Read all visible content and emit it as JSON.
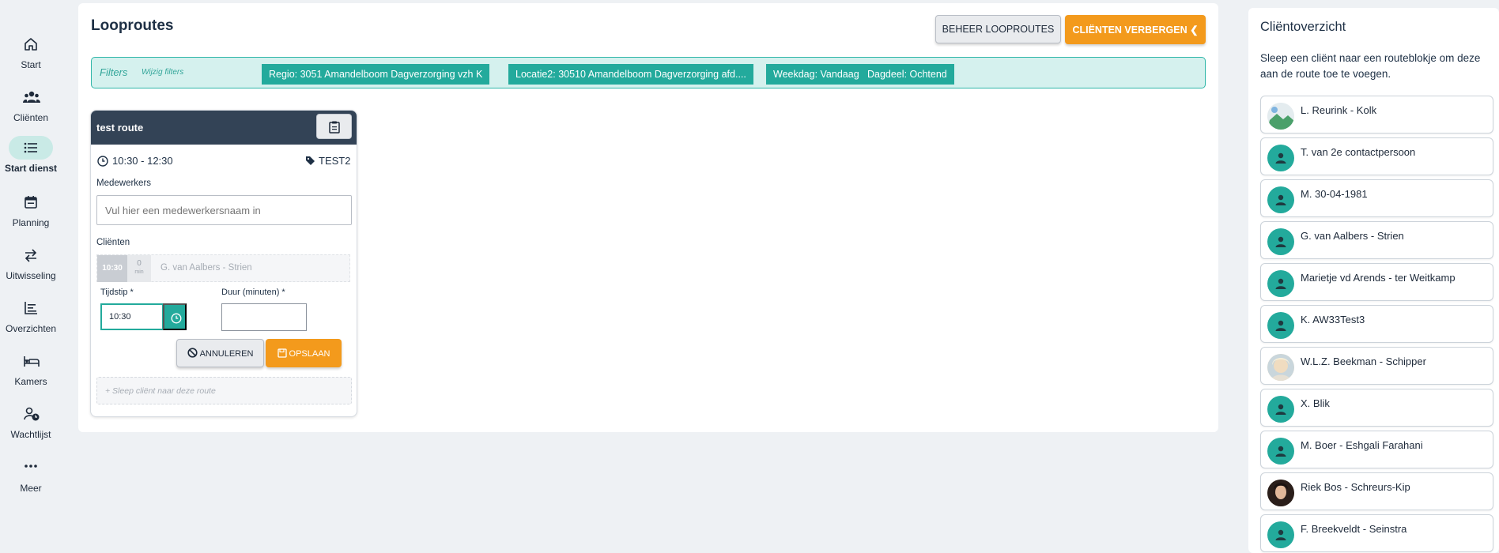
{
  "sidebar": {
    "items": [
      {
        "label": "Start",
        "icon": "home-icon"
      },
      {
        "label": "Cliënten",
        "icon": "users-icon"
      },
      {
        "label": "Start dienst",
        "icon": "list-icon",
        "active": true
      },
      {
        "label": "Planning",
        "icon": "calendar-icon"
      },
      {
        "label": "Uitwisseling",
        "icon": "exchange-icon"
      },
      {
        "label": "Overzichten",
        "icon": "chart-icon"
      },
      {
        "label": "Kamers",
        "icon": "bed-icon"
      },
      {
        "label": "Wachtlijst",
        "icon": "user-clock-icon"
      },
      {
        "label": "Meer",
        "icon": "more-icon"
      }
    ]
  },
  "header": {
    "title": "Looproutes",
    "beheer_label": "BEHEER LOOPROUTES",
    "verbergen_label": "CLIËNTEN VERBERGEN"
  },
  "filters": {
    "title": "Filters",
    "edit_label": "Wijzig filters",
    "chips": [
      "Regio: 3051 Amandelboom Dagverzorging vzh K",
      "Locatie2: 30510 Amandelboom Dagverzorging afd....",
      "Weekdag: Vandaag",
      "Dagdeel: Ochtend"
    ]
  },
  "route": {
    "name": "test route",
    "time": "10:30 - 12:30",
    "tag": "TEST2",
    "medewerkers_label": "Medewerkers",
    "medewerkers_placeholder": "Vul hier een medewerkersnaam in",
    "clienten_label": "Cliënten",
    "client_row": {
      "time": "10:30",
      "duration": "0",
      "duration_unit": "min",
      "name": "G. van Aalbers - Strien"
    },
    "tijdstip_label": "Tijdstip *",
    "tijdstip_value": "10:30",
    "duur_label": "Duur (minuten) *",
    "annuleren_label": "ANNULEREN",
    "opslaan_label": "OPSLAAN",
    "dropzone_text": "+ Sleep cliënt naar deze route"
  },
  "client_panel": {
    "title": "Cliëntoverzicht",
    "description": "Sleep een cliënt naar een routeblokje om deze aan de route toe te voegen.",
    "clients": [
      {
        "name": "L. Reurink - Kolk",
        "avatar": "broken-photo"
      },
      {
        "name": "T. van 2e contactpersoon",
        "avatar": "default"
      },
      {
        "name": "M. 30-04-1981",
        "avatar": "default"
      },
      {
        "name": "G. van Aalbers - Strien",
        "avatar": "default"
      },
      {
        "name": "Marietje vd Arends - ter Weitkamp",
        "avatar": "default"
      },
      {
        "name": "K. AW33Test3",
        "avatar": "default"
      },
      {
        "name": "W.L.Z. Beekman - Schipper",
        "avatar": "photo-blonde"
      },
      {
        "name": "X. Blik",
        "avatar": "default"
      },
      {
        "name": "M. Boer - Eshgali Farahani",
        "avatar": "default"
      },
      {
        "name": "Riek Bos - Schreurs-Kip",
        "avatar": "photo-dark"
      },
      {
        "name": "F. Breekveldt - Seinstra",
        "avatar": "default"
      }
    ]
  },
  "colors": {
    "accent_teal": "#23aa9c",
    "accent_orange": "#f39a1c",
    "header_dark": "#334356"
  }
}
